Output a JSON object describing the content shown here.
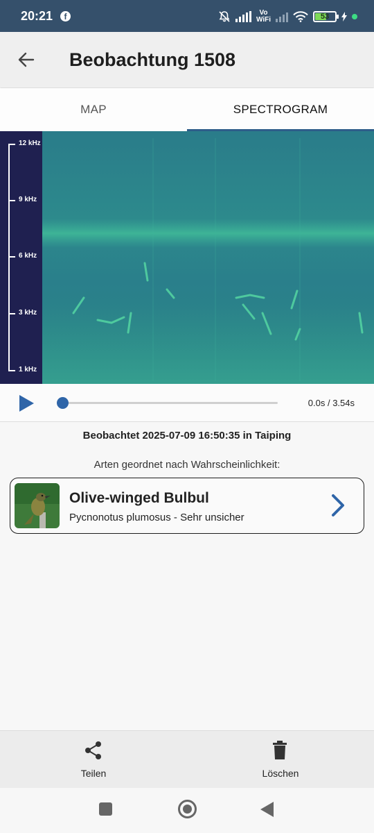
{
  "status_bar": {
    "time": "20:21",
    "notification_icon": "facebook-icon",
    "volte_label": "Vo\nWiFi",
    "battery_level": "53",
    "accent_color": "#35506b"
  },
  "app_bar": {
    "title": "Beobachtung 1508",
    "back_icon": "arrow-left-icon"
  },
  "tabs": [
    {
      "label": "MAP",
      "selected": false
    },
    {
      "label": "SPECTROGRAM",
      "selected": true
    }
  ],
  "spectrogram": {
    "y_labels": [
      "12 kHz",
      "9 kHz",
      "6 kHz",
      "3 kHz",
      "1 kHz"
    ],
    "axis_color": "#1f2050",
    "heat_color": "#2a8a8a"
  },
  "player": {
    "play_icon": "play-icon",
    "time_readout": "0.0s / 3.54s",
    "progress": 0.0
  },
  "observation": {
    "observed_text": "Beobachtet 2025-07-09 16:50:35 in Taiping",
    "species_header": "Arten geordnet nach Wahrscheinlichkeit:"
  },
  "species": [
    {
      "common_name": "Olive-winged Bulbul",
      "subtitle": "Pycnonotus plumosus - Sehr unsicher",
      "thumbnail_icon": "bird-photo",
      "chevron_icon": "chevron-right-icon"
    }
  ],
  "bottom_bar": {
    "share_label": "Teilen",
    "share_icon": "share-icon",
    "delete_label": "Löschen",
    "delete_icon": "trash-icon"
  },
  "nav_bar": {
    "recents_icon": "square-icon",
    "home_icon": "circle-home-icon",
    "back_icon": "triangle-back-icon"
  }
}
